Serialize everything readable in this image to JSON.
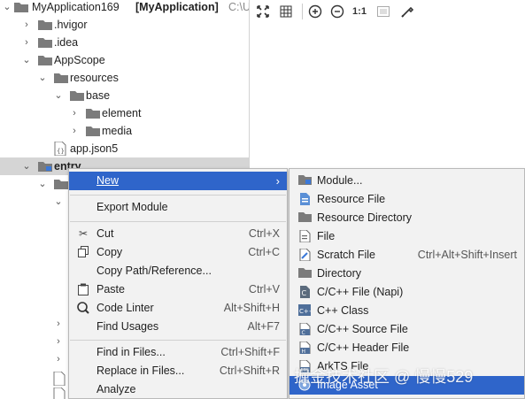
{
  "tree": {
    "project_name": "MyApplication169",
    "project_module": "[MyApplication]",
    "project_path": "C:\\U",
    "items": [
      {
        "label": ".hvigor"
      },
      {
        "label": ".idea"
      },
      {
        "label": "AppScope"
      },
      {
        "label": "resources"
      },
      {
        "label": "base"
      },
      {
        "label": "element"
      },
      {
        "label": "media"
      },
      {
        "label": "app.json5"
      },
      {
        "label": "entry"
      }
    ]
  },
  "toolbar": {
    "icons": [
      "fit-screen-icon",
      "grid-icon",
      "zoom-in-icon",
      "zoom-out-icon",
      "actual-size-icon",
      "background-icon",
      "color-picker-icon"
    ],
    "actual_size_label": "1:1"
  },
  "context_menu": {
    "items": [
      {
        "label": "New",
        "shortcut": "",
        "icon": ""
      },
      {
        "label": "Export Module",
        "shortcut": "",
        "icon": ""
      },
      {
        "label": "Cut",
        "shortcut": "Ctrl+X",
        "icon": "scissors-icon"
      },
      {
        "label": "Copy",
        "shortcut": "Ctrl+C",
        "icon": "copy-icon"
      },
      {
        "label": "Copy Path/Reference...",
        "shortcut": "",
        "icon": ""
      },
      {
        "label": "Paste",
        "shortcut": "Ctrl+V",
        "icon": "paste-icon"
      },
      {
        "label": "Code Linter",
        "shortcut": "Alt+Shift+H",
        "icon": "code-linter-icon"
      },
      {
        "label": "Find Usages",
        "shortcut": "Alt+F7",
        "icon": ""
      },
      {
        "label": "Find in Files...",
        "shortcut": "Ctrl+Shift+F",
        "icon": ""
      },
      {
        "label": "Replace in Files...",
        "shortcut": "Ctrl+Shift+R",
        "icon": ""
      },
      {
        "label": "Analyze",
        "shortcut": "",
        "icon": ""
      }
    ]
  },
  "new_submenu": {
    "items": [
      {
        "label": "Module...",
        "shortcut": "",
        "icon": "module-icon"
      },
      {
        "label": "Resource File",
        "shortcut": "",
        "icon": "resource-file-icon"
      },
      {
        "label": "Resource Directory",
        "shortcut": "",
        "icon": "folder-icon"
      },
      {
        "label": "File",
        "shortcut": "",
        "icon": "file-icon"
      },
      {
        "label": "Scratch File",
        "shortcut": "Ctrl+Alt+Shift+Insert",
        "icon": "scratch-file-icon"
      },
      {
        "label": "Directory",
        "shortcut": "",
        "icon": "folder-icon"
      },
      {
        "label": "C/C++ File (Napi)",
        "shortcut": "",
        "icon": "cpp-napi-icon"
      },
      {
        "label": "C++ Class",
        "shortcut": "",
        "icon": "cpp-class-icon"
      },
      {
        "label": "C/C++ Source File",
        "shortcut": "",
        "icon": "cpp-source-icon"
      },
      {
        "label": "C/C++ Header File",
        "shortcut": "",
        "icon": "cpp-header-icon"
      },
      {
        "label": "ArkTS File",
        "shortcut": "",
        "icon": "arkts-file-icon"
      },
      {
        "label": "Image Asset",
        "shortcut": "",
        "icon": "image-asset-icon"
      }
    ]
  },
  "colors": {
    "highlight": "#2f65ca",
    "menu_bg": "#f2f2f2",
    "tree_selection": "#d5d5d5"
  },
  "watermark": "掘金技术社区 @ 慢慢529"
}
